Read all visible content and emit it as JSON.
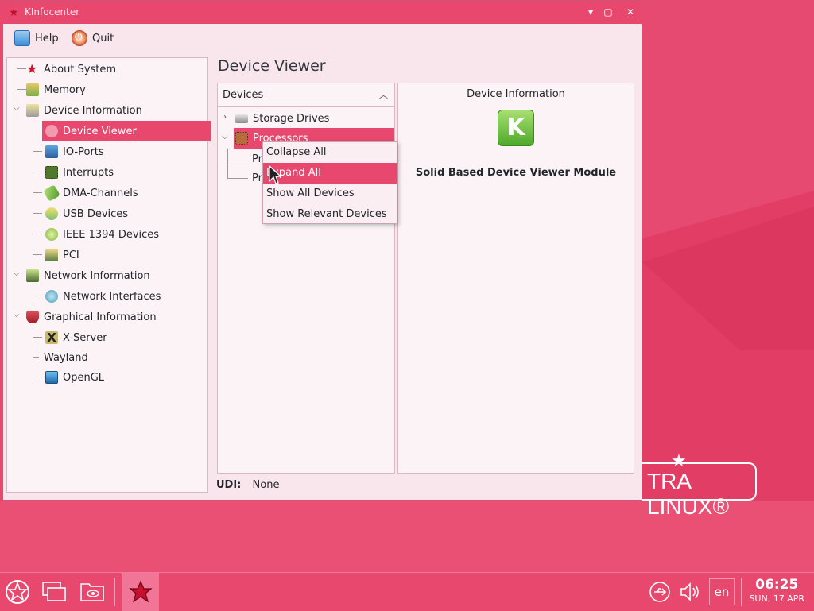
{
  "window": {
    "title": "KInfocenter"
  },
  "toolbar": {
    "help_label": "Help",
    "quit_label": "Quit"
  },
  "sidebar": {
    "items": [
      {
        "label": "About System",
        "icon": "star-icon"
      },
      {
        "label": "Memory",
        "icon": "memory-icon"
      },
      {
        "label": "Device Information",
        "icon": "device-info-icon"
      },
      {
        "label": "Device Viewer",
        "icon": "device-viewer-icon"
      },
      {
        "label": "IO-Ports",
        "icon": "io-ports-icon"
      },
      {
        "label": "Interrupts",
        "icon": "chip-icon"
      },
      {
        "label": "DMA-Channels",
        "icon": "dma-icon"
      },
      {
        "label": "USB Devices",
        "icon": "usb-icon"
      },
      {
        "label": "IEEE 1394 Devices",
        "icon": "ieee1394-icon"
      },
      {
        "label": "PCI",
        "icon": "pci-icon"
      },
      {
        "label": "Network Information",
        "icon": "network-icon"
      },
      {
        "label": "Network Interfaces",
        "icon": "network-interface-icon"
      },
      {
        "label": "Graphical Information",
        "icon": "graphics-icon"
      },
      {
        "label": "X-Server",
        "icon": "x-server-icon"
      },
      {
        "label": "Wayland",
        "icon": ""
      },
      {
        "label": "OpenGL",
        "icon": "opengl-icon"
      }
    ]
  },
  "main": {
    "title": "Device Viewer",
    "devices_header": "Devices",
    "device_rows": [
      {
        "label": "Storage Drives",
        "icon": "drive-icon"
      },
      {
        "label": "Processors",
        "icon": "processor-icon"
      },
      {
        "label": "Pr"
      },
      {
        "label": "Pr"
      }
    ],
    "info": {
      "title": "Device Information",
      "logo_text": "K",
      "module_name": "Solid Based Device Viewer Module"
    },
    "udi_label": "UDI:",
    "udi_value": "None"
  },
  "context_menu": {
    "items": [
      "Collapse All",
      "Expand All",
      "Show All Devices",
      "Show Relevant Devices"
    ],
    "highlighted_index": 1
  },
  "taskbar": {
    "lang": "en",
    "time": "06:25",
    "date": "SUN, 17 APR"
  },
  "wallpaper": {
    "logo_text": "TRA LINUX®"
  },
  "colors": {
    "accent": "#e8476e",
    "accent_light": "#f07596"
  }
}
